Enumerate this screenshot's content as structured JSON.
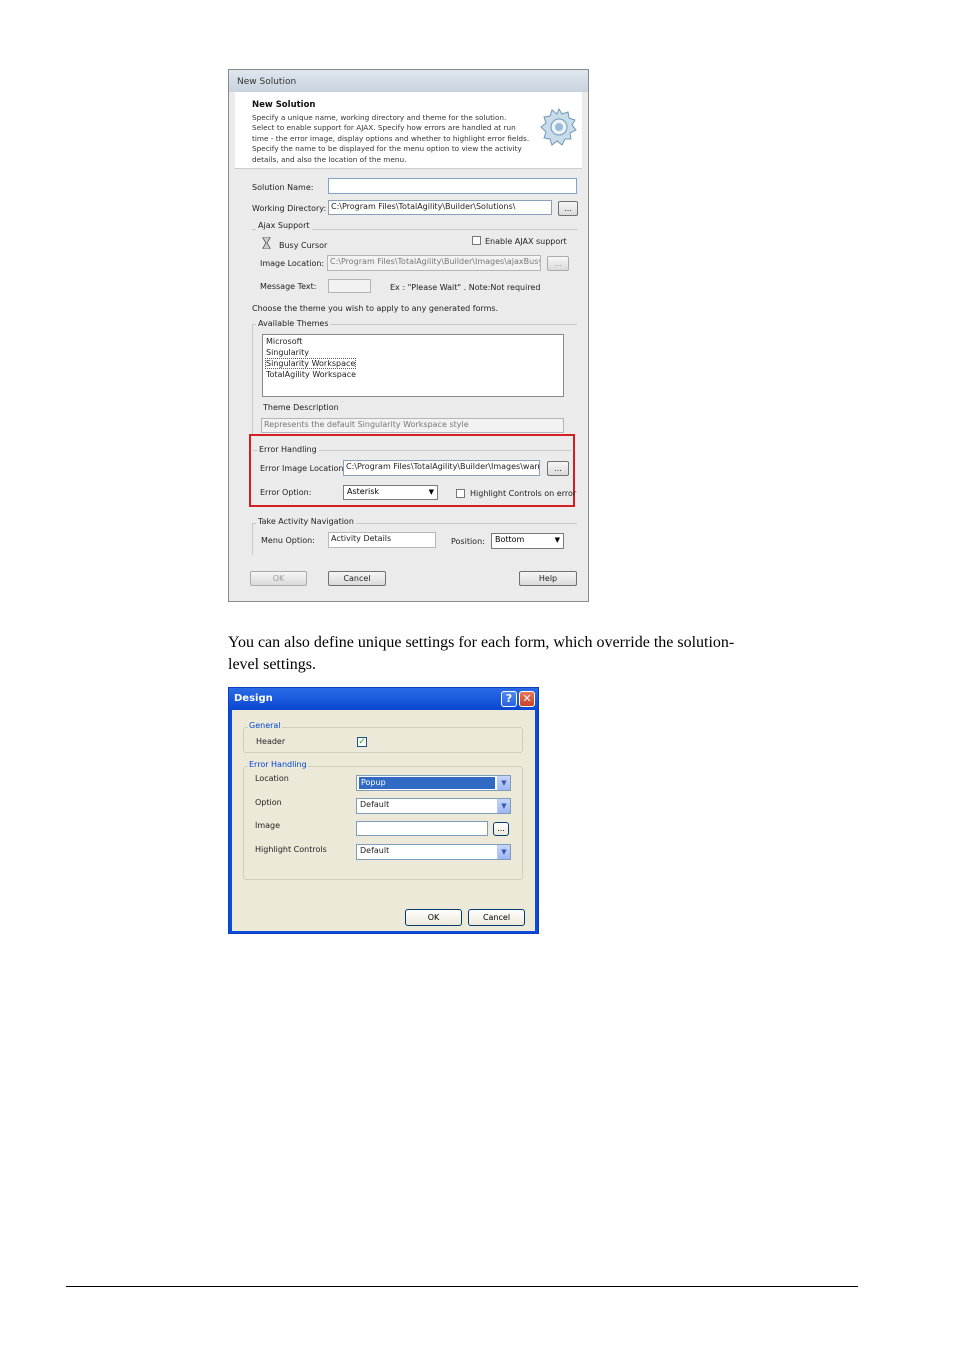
{
  "new_solution": {
    "title": "New Solution",
    "header_title": "New Solution",
    "header_desc": [
      "Specify a unique name, working directory and theme for the solution.",
      "Select to enable support for AJAX. Specify how errors are handled at run",
      "time - the error image, display options and whether to highlight error fields.",
      "Specify the name to be displayed for the menu option to view the activity",
      "details, and also the location of the menu."
    ],
    "solution_name_label": "Solution Name:",
    "solution_name_value": "",
    "working_dir_label": "Working Directory:",
    "working_dir_value": "C:\\Program Files\\TotalAgility\\Builder\\Solutions\\",
    "browse_label": "...",
    "ajax": {
      "legend": "Ajax Support",
      "busy_cursor_label": "Busy Cursor",
      "enable_label": "Enable AJAX support",
      "image_location_label": "Image Location:",
      "image_location_value": "C:\\Program Files\\TotalAgility\\Builder\\Images\\ajaxBusy.gi",
      "message_text_label": "Message Text:",
      "message_text_value": "",
      "message_hint": "Ex : \"Please Wait\" .  Note:Not required"
    },
    "theme_prompt": "Choose the theme you wish to apply to any generated forms.",
    "themes": {
      "legend": "Available Themes",
      "items": [
        "Microsoft",
        "Singularity",
        "Singularity Workspace",
        "TotalAgility Workspace"
      ],
      "selected_index": 2,
      "description_label": "Theme Description",
      "description_value": "Represents the default Singularity Workspace style"
    },
    "error_handling": {
      "legend": "Error Handling",
      "image_location_label": "Error Image Location:",
      "image_location_value": "C:\\Program Files\\TotalAgility\\Builder\\Images\\warnir",
      "option_label": "Error Option:",
      "option_value": "Asterisk",
      "highlight_label": "Highlight Controls on error",
      "highlight_color": "#d42020"
    },
    "navigation": {
      "legend": "Take Activity Navigation",
      "menu_option_label": "Menu Option:",
      "menu_option_value": "Activity Details",
      "position_label": "Position:",
      "position_value": "Bottom"
    },
    "ok_label": "OK",
    "cancel_label": "Cancel",
    "help_label": "Help"
  },
  "body_text": "You can also define unique settings for each form, which override the solution-level settings.",
  "body_text_lines": [
    "You can also define unique settings for each form, which override the solution-",
    "level settings."
  ],
  "design": {
    "title": "Design",
    "help_icon": "question-icon",
    "close_icon": "close-icon",
    "general_legend": "General",
    "header_label": "Header",
    "header_checked": true,
    "error_legend": "Error Handling",
    "location_label": "Location",
    "location_value": "Popup",
    "option_label": "Option",
    "option_value": "Default",
    "image_label": "Image",
    "image_value": "",
    "highlight_label": "Highlight Controls",
    "highlight_value": "Default",
    "browse_label": "...",
    "ok_label": "OK",
    "cancel_label": "Cancel"
  }
}
